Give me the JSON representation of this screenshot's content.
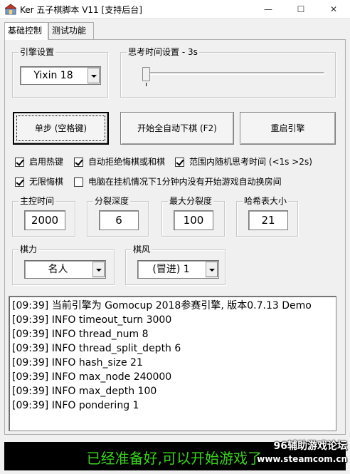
{
  "window": {
    "title": "Ker 五子棋脚本 V11 [支持后台]",
    "minimize_glyph": "—",
    "maximize_glyph": "☐",
    "close_glyph": "✕"
  },
  "tabs": [
    {
      "label": "基础控制",
      "active": true
    },
    {
      "label": "测试功能",
      "active": false
    }
  ],
  "engine": {
    "group_label": "引擎设置",
    "selected": "Yixin 18"
  },
  "think_time": {
    "group_label": "思考时间设置 - 3s",
    "slider_value_seconds": 3
  },
  "buttons": {
    "step": "单步 (空格键)",
    "auto": "开始全自动下棋 (F2)",
    "restart": "重启引擎"
  },
  "checkboxes": [
    {
      "label": "启用热键",
      "checked": true
    },
    {
      "label": "自动拒绝悔棋或和棋",
      "checked": true
    },
    {
      "label": "范围内随机思考时间 (<1s  >2s)",
      "checked": true
    },
    {
      "label": "无限悔棋",
      "checked": true
    },
    {
      "label": "电脑在挂机情况下1分钟内没有开始游戏自动换房间",
      "checked": false
    }
  ],
  "params": [
    {
      "label": "主控时间",
      "value": "2000"
    },
    {
      "label": "分裂深度",
      "value": "6"
    },
    {
      "label": "最大分裂度",
      "value": "100"
    },
    {
      "label": "哈希表大小",
      "value": "21"
    }
  ],
  "skill": {
    "group_label": "棋力",
    "selected": "名人"
  },
  "style": {
    "group_label": "棋风",
    "selected": "(冒进) 1"
  },
  "log_lines": [
    "[09:39] 当前引擎为 Gomocup 2018参赛引擎, 版本0.7.13 Demo",
    "[09:39] INFO timeout_turn 3000",
    "[09:39] INFO thread_num 8",
    "[09:39] INFO thread_split_depth 6",
    "[09:39] INFO hash_size 21",
    "[09:39] INFO max_node 240000",
    "[09:39] INFO max_depth 100",
    "[09:39] INFO pondering 1"
  ],
  "status": {
    "text": "已经准备好,可以开始游戏了",
    "color": "#39d31a"
  },
  "watermark": {
    "line1": "96辅助游戏论坛",
    "line2": "www.steamcom.cn"
  }
}
